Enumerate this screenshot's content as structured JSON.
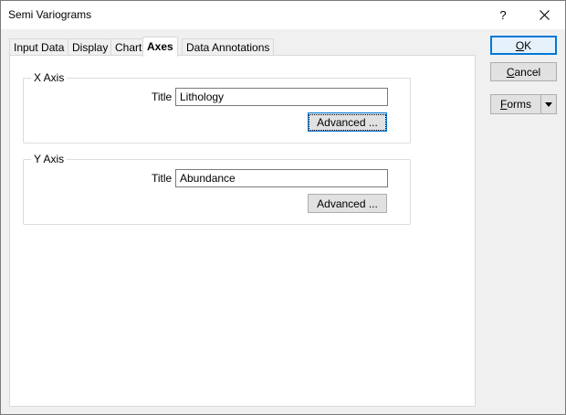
{
  "window": {
    "title": "Semi Variograms",
    "help_label": "?"
  },
  "tabs": [
    {
      "label": "Input Data",
      "active": false
    },
    {
      "label": "Display",
      "active": false
    },
    {
      "label": "Chart",
      "active": false
    },
    {
      "label": "Axes",
      "active": true
    },
    {
      "label": "Data Annotations",
      "active": false
    }
  ],
  "x_axis": {
    "group_label": "X Axis",
    "title_label": "Title",
    "title_value": "Lithology",
    "advanced_label": "Advanced ..."
  },
  "y_axis": {
    "group_label": "Y Axis",
    "title_label": "Title",
    "title_value": "Abundance",
    "advanced_label": "Advanced ..."
  },
  "buttons": {
    "ok_label": "OK",
    "cancel_label": "Cancel",
    "forms_label": "Forms"
  },
  "colors": {
    "accent": "#0078d7",
    "dialog_bg": "#f0f0f0",
    "panel_bg": "#ffffff"
  },
  "icons": {
    "close": "close-icon",
    "dropdown": "chevron-down-icon"
  }
}
